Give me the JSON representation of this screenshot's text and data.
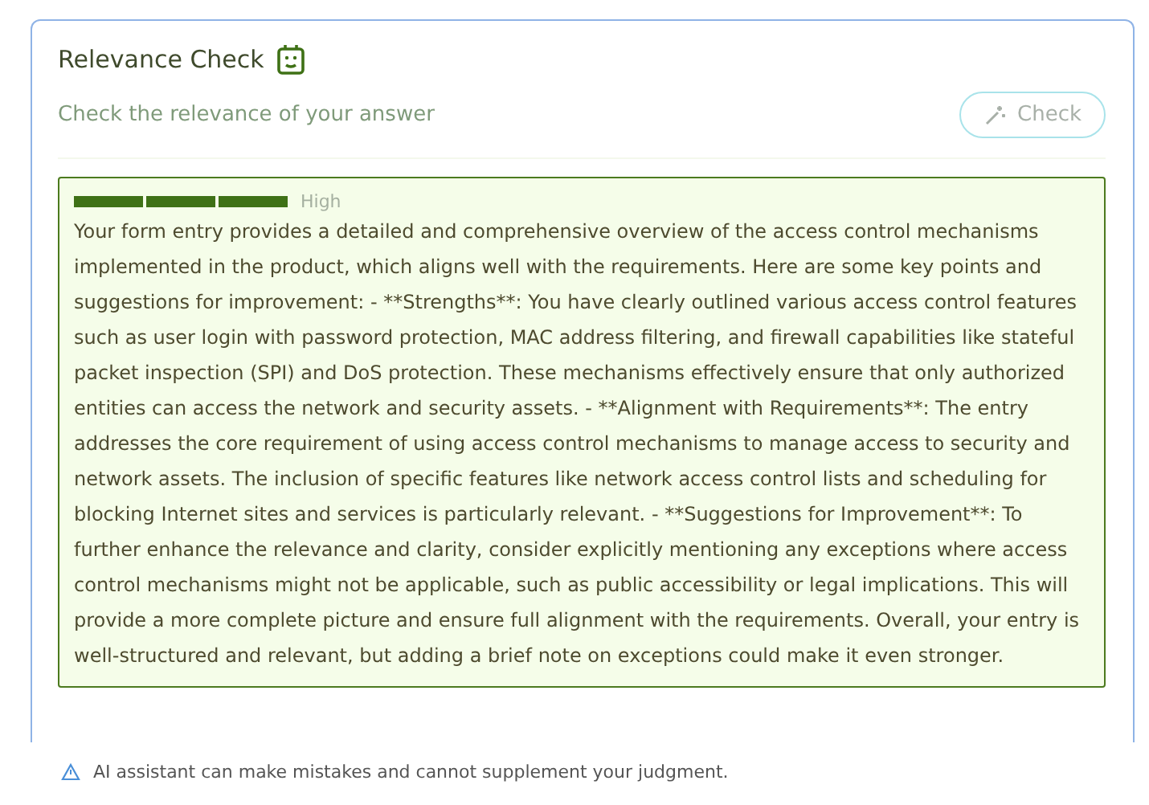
{
  "card": {
    "title": "Relevance Check",
    "subtitle": "Check the relevance of your answer",
    "check_button": {
      "label": "Check",
      "disabled": true
    }
  },
  "result": {
    "meter": {
      "level": 1,
      "label": "High"
    },
    "text": "Your form entry provides a detailed and comprehensive overview of the access control mechanisms implemented in the product, which aligns well with the requirements. Here are some key points and suggestions for improvement: - **Strengths**: You have clearly outlined various access control features such as user login with password protection, MAC address filtering, and firewall capabilities like stateful packet inspection (SPI) and DoS protection. These mechanisms effectively ensure that only authorized entities can access the network and security assets. - **Alignment with Requirements**: The entry addresses the core requirement of using access control mechanisms to manage access to security and network assets. The inclusion of specific features like network access control lists and scheduling for blocking Internet sites and services is particularly relevant. - **Suggestions for Improvement**: To further enhance the relevance and clarity, consider explicitly mentioning any exceptions where access control mechanisms might not be applicable, such as public accessibility or legal implications. This will provide a more complete picture and ensure full alignment with the requirements. Overall, your entry is well-structured and relevant, but adding a brief note on exceptions could make it even stronger."
  },
  "disclaimer": "AI assistant can make mistakes and cannot supplement your judgment."
}
